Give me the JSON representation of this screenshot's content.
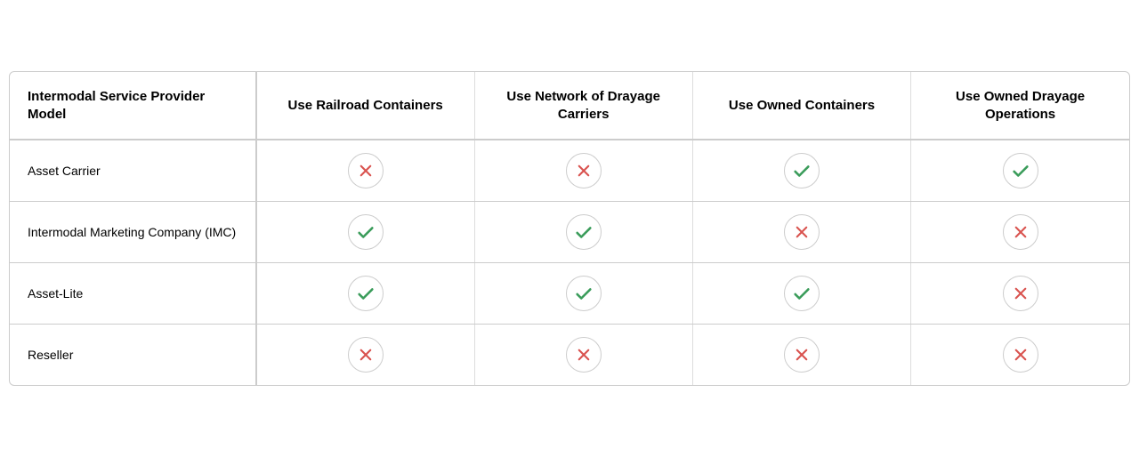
{
  "table": {
    "headers": [
      {
        "id": "model",
        "label": "Intermodal Service Provider Model"
      },
      {
        "id": "railroad",
        "label": "Use Railroad Containers"
      },
      {
        "id": "drayage",
        "label": "Use Network of Drayage Carriers"
      },
      {
        "id": "owned-containers",
        "label": "Use Owned Containers"
      },
      {
        "id": "owned-drayage",
        "label": "Use Owned Drayage Operations"
      }
    ],
    "rows": [
      {
        "label": "Asset Carrier",
        "values": [
          "cross",
          "cross",
          "check",
          "check"
        ]
      },
      {
        "label": "Intermodal Marketing Company (IMC)",
        "values": [
          "check",
          "check",
          "cross",
          "cross"
        ]
      },
      {
        "label": "Asset-Lite",
        "values": [
          "check",
          "check",
          "check",
          "cross"
        ]
      },
      {
        "label": "Reseller",
        "values": [
          "cross",
          "cross",
          "cross",
          "cross"
        ]
      }
    ]
  }
}
